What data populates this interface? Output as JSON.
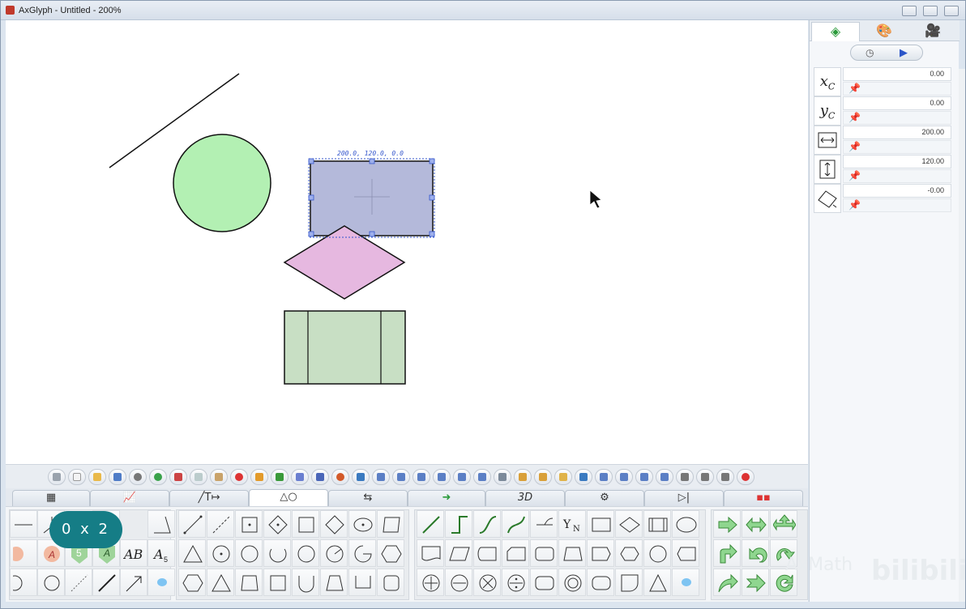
{
  "window": {
    "title": "AxGlyph - Untitled - 200%"
  },
  "canvas": {
    "selection_label": "200.0, 120.0, 0.0",
    "colors": {
      "circle": "#b3f0b3",
      "rect": "#b4b9da",
      "diamond": "#e6b8e0",
      "panel": "#c8dfc4",
      "selection": "#3355cc"
    }
  },
  "zoom_badge": "0 x 2",
  "tabs": [
    {
      "label": ""
    },
    {
      "label": ""
    },
    {
      "label": "T"
    },
    {
      "label": ""
    },
    {
      "label": ""
    },
    {
      "label": ""
    },
    {
      "label": "3D"
    },
    {
      "label": ""
    },
    {
      "label": ""
    },
    {
      "label": ""
    }
  ],
  "palette": {
    "text_buttons": [
      "AB",
      "A",
      "5",
      "A"
    ],
    "subscript_label": "A",
    "subscript": "5",
    "yn_label": "Y",
    "yn_sub": "N"
  },
  "properties": [
    {
      "symbol": "x",
      "sub": "C",
      "value": "0.00"
    },
    {
      "symbol": "y",
      "sub": "C",
      "value": "0.00"
    },
    {
      "symbol": "",
      "sub": "",
      "value": "200.00"
    },
    {
      "symbol": "",
      "sub": "",
      "value": "120.00"
    },
    {
      "symbol": "",
      "sub": "",
      "value": "-0.00"
    }
  ],
  "watermark": {
    "axmath": "AxMath",
    "bili": "bilibili"
  }
}
